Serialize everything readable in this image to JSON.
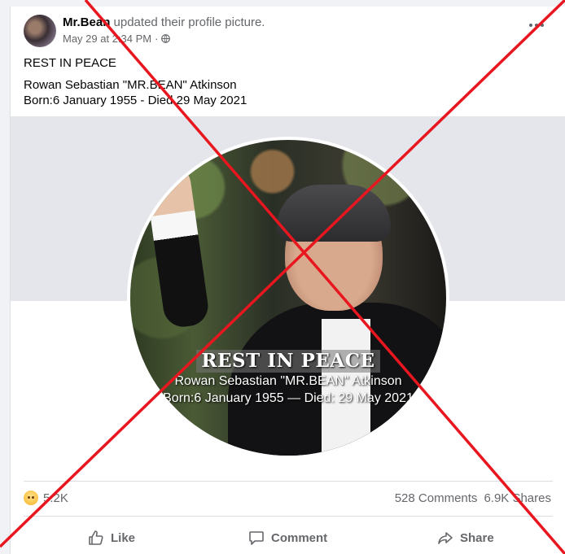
{
  "post": {
    "author": "Mr.Bean",
    "action_text": "updated their profile picture.",
    "timestamp": "May 29 at 2:34 PM",
    "separator": "·",
    "privacy_icon": "globe-icon",
    "more_icon": "more-options-icon",
    "text_line1": "REST IN PEACE",
    "text_line2": "Rowan Sebastian \"MR.BEAN\" Atkinson",
    "text_line3": "Born:6 January 1955 - Died 29 May 2021"
  },
  "photo": {
    "overlay_title": "REST IN PEACE",
    "overlay_name": "Rowan Sebastian \"MR.BEAN\" Atkinson",
    "overlay_dates": "Born:6 January 1955 — Died: 29 May 2021"
  },
  "stats": {
    "reaction_icon": "sad-reaction-icon",
    "reaction_count": "5.2K",
    "comments": "528 Comments",
    "shares": "6.9K Shares"
  },
  "actions": {
    "like_label": "Like",
    "comment_label": "Comment",
    "share_label": "Share"
  },
  "overlay_mark": {
    "color": "#e8161e"
  }
}
